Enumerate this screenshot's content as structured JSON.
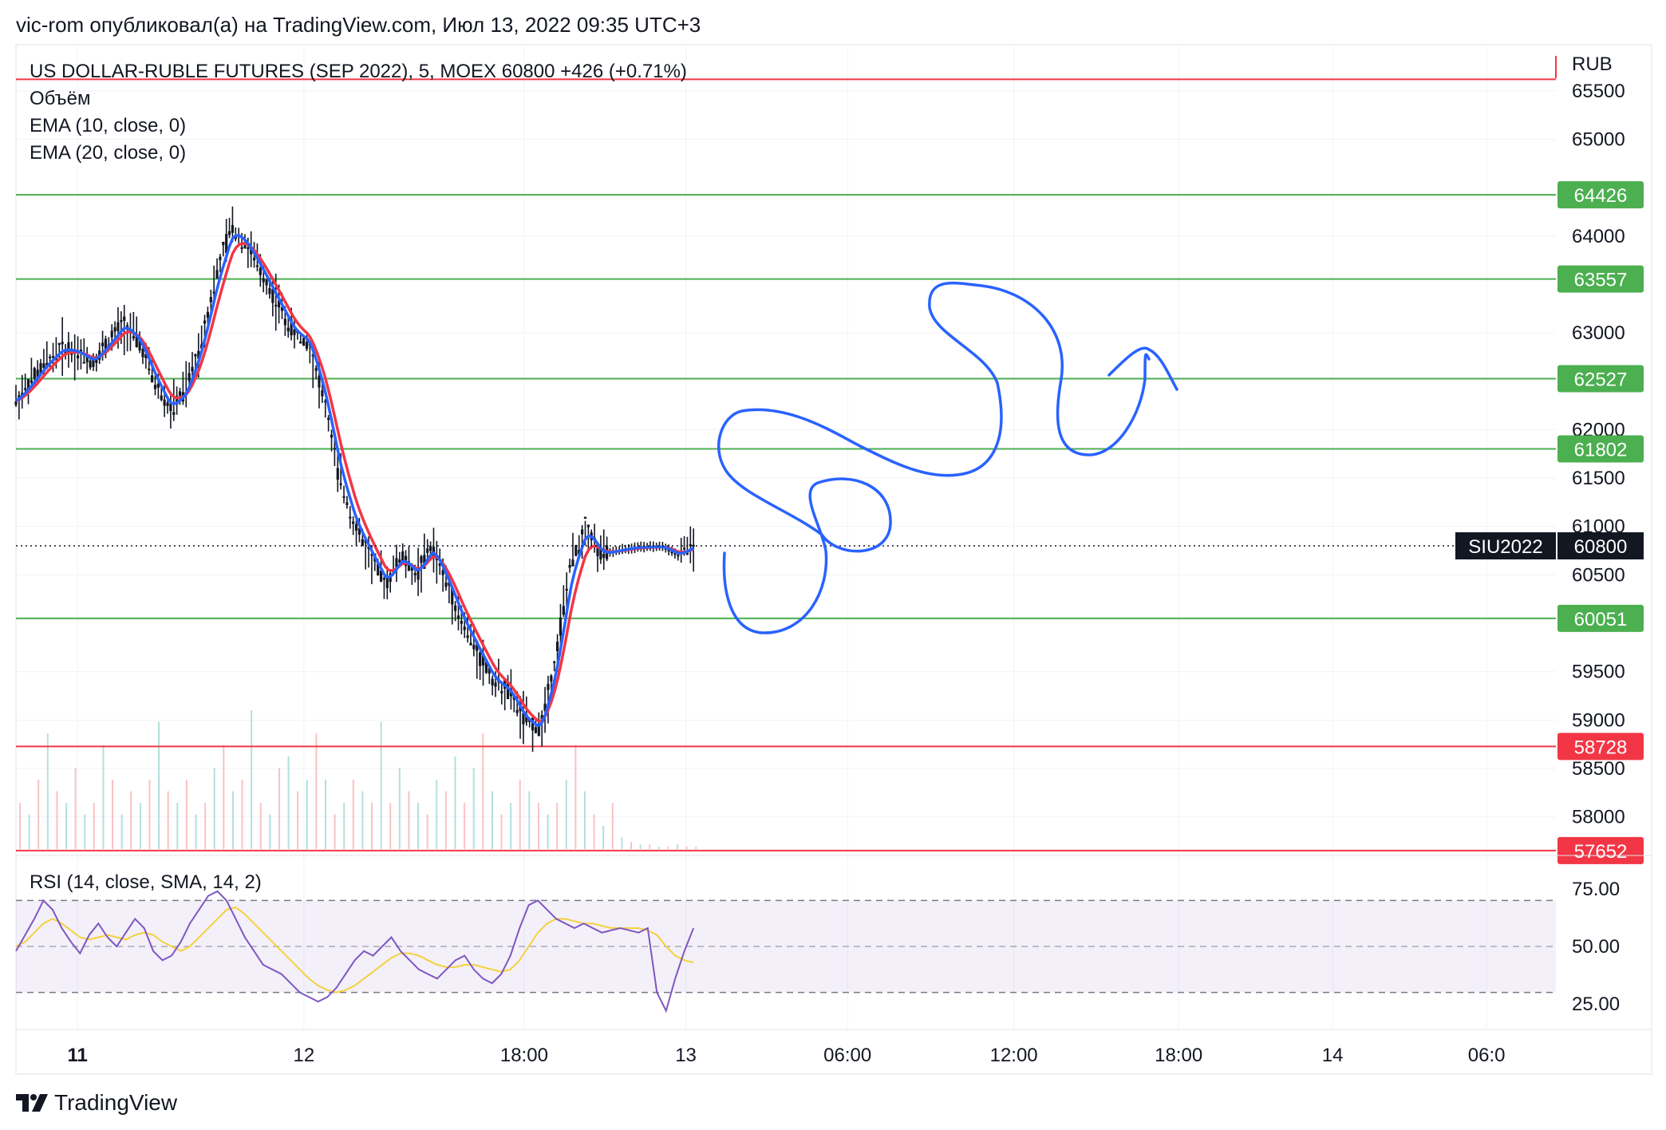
{
  "header": {
    "publisher_line": "vic-rom опубликовал(а) на TradingView.com, Июл 13, 2022 09:35 UTC+3"
  },
  "legend": {
    "title": "US DOLLAR-RUBLE FUTURES (SEP 2022), 5, MOEX  60800  +426 (+0.71%)",
    "volume": "Объём",
    "ema10": "EMA (10, close, 0)",
    "ema20": "EMA (20, close, 0)",
    "rsi": "RSI (14, close, SMA, 14, 2)"
  },
  "footer": {
    "brand": "TradingView"
  },
  "colors": {
    "level_line": "#4caf50",
    "red_line": "#f23645",
    "ema10": "#2962ff",
    "ema20": "#f23645",
    "rsi": "#7e57c2",
    "rsi_ma": "#f5d13d",
    "rsi_band": "#7e57c2",
    "drawing": "#2962ff",
    "candle": "#131722"
  },
  "chart_data": {
    "type": "candlestick",
    "symbol": "SIU2022",
    "currency": "RUB",
    "last_price": 60800,
    "change": "+426 (+0.71%)",
    "price_axis": {
      "range": [
        57700,
        65700
      ],
      "ticks": [
        "65500",
        "65000",
        "64000",
        "63000",
        "62000",
        "61500",
        "61000",
        "60500",
        "59500",
        "59000",
        "58500",
        "58000"
      ]
    },
    "time_axis": {
      "ticks": [
        {
          "label": "11",
          "bold": true,
          "pos": 0.04
        },
        {
          "label": "12",
          "bold": false,
          "pos": 0.187
        },
        {
          "label": "18:00",
          "bold": false,
          "pos": 0.33
        },
        {
          "label": "13",
          "bold": false,
          "pos": 0.435
        },
        {
          "label": "06:00",
          "bold": false,
          "pos": 0.54
        },
        {
          "label": "12:00",
          "bold": false,
          "pos": 0.648
        },
        {
          "label": "18:00",
          "bold": false,
          "pos": 0.755
        },
        {
          "label": "14",
          "bold": false,
          "pos": 0.855
        },
        {
          "label": "06:0",
          "bold": false,
          "pos": 0.955
        }
      ]
    },
    "levels": [
      {
        "price": 64426,
        "label": "64426",
        "color": "green"
      },
      {
        "price": 63557,
        "label": "63557",
        "color": "green"
      },
      {
        "price": 62527,
        "label": "62527",
        "color": "green"
      },
      {
        "price": 61802,
        "label": "61802",
        "color": "green"
      },
      {
        "price": 60051,
        "label": "60051",
        "color": "green"
      },
      {
        "price": 58728,
        "label": "58728",
        "color": "red"
      },
      {
        "price": 57652,
        "label": "57652",
        "color": "red"
      },
      {
        "price": 65620,
        "label": "",
        "color": "red"
      }
    ],
    "last_price_tag": {
      "symbol": "SIU2022",
      "price": "60800"
    },
    "price_path": [
      [
        0,
        62300
      ],
      [
        0.01,
        62500
      ],
      [
        0.02,
        62700
      ],
      [
        0.03,
        62850
      ],
      [
        0.04,
        62800
      ],
      [
        0.05,
        62700
      ],
      [
        0.06,
        62900
      ],
      [
        0.07,
        63100
      ],
      [
        0.08,
        62900
      ],
      [
        0.09,
        62500
      ],
      [
        0.1,
        62200
      ],
      [
        0.11,
        62400
      ],
      [
        0.12,
        62900
      ],
      [
        0.13,
        63600
      ],
      [
        0.14,
        64100
      ],
      [
        0.15,
        63900
      ],
      [
        0.16,
        63600
      ],
      [
        0.17,
        63300
      ],
      [
        0.18,
        63000
      ],
      [
        0.19,
        62900
      ],
      [
        0.2,
        62300
      ],
      [
        0.21,
        61500
      ],
      [
        0.22,
        61000
      ],
      [
        0.23,
        60700
      ],
      [
        0.24,
        60400
      ],
      [
        0.25,
        60700
      ],
      [
        0.26,
        60500
      ],
      [
        0.27,
        60800
      ],
      [
        0.28,
        60400
      ],
      [
        0.29,
        60000
      ],
      [
        0.3,
        59700
      ],
      [
        0.31,
        59400
      ],
      [
        0.32,
        59300
      ],
      [
        0.33,
        59000
      ],
      [
        0.34,
        58900
      ],
      [
        0.35,
        59600
      ],
      [
        0.36,
        60600
      ],
      [
        0.37,
        61000
      ],
      [
        0.38,
        60700
      ],
      [
        0.39,
        60750
      ],
      [
        0.4,
        60780
      ],
      [
        0.41,
        60790
      ],
      [
        0.42,
        60790
      ],
      [
        0.43,
        60700
      ],
      [
        0.44,
        60800
      ]
    ],
    "volume": [
      0.2,
      0.15,
      0.3,
      0.5,
      0.25,
      0.2,
      0.35,
      0.15,
      0.2,
      0.45,
      0.3,
      0.15,
      0.25,
      0.2,
      0.3,
      0.55,
      0.25,
      0.2,
      0.3,
      0.15,
      0.2,
      0.35,
      0.45,
      0.25,
      0.3,
      0.6,
      0.2,
      0.15,
      0.35,
      0.4,
      0.25,
      0.3,
      0.5,
      0.3,
      0.15,
      0.2,
      0.3,
      0.25,
      0.2,
      0.55,
      0.2,
      0.35,
      0.25,
      0.2,
      0.15,
      0.3,
      0.25,
      0.4,
      0.2,
      0.35,
      0.5,
      0.25,
      0.15,
      0.2,
      0.3,
      0.25,
      0.2,
      0.15,
      0.2,
      0.3,
      0.45,
      0.25,
      0.15,
      0.1,
      0.2,
      0.05,
      0.03,
      0.02,
      0.02,
      0.01,
      0.01,
      0.02,
      0.01,
      0.01
    ],
    "rsi": {
      "axis_ticks": [
        "75.00",
        "50.00",
        "25.00"
      ],
      "band": [
        30,
        70
      ],
      "middle": 50,
      "values": [
        48,
        55,
        62,
        70,
        66,
        58,
        52,
        47,
        55,
        60,
        54,
        50,
        56,
        62,
        58,
        48,
        44,
        46,
        52,
        60,
        66,
        72,
        74,
        70,
        62,
        54,
        48,
        42,
        40,
        38,
        34,
        30,
        28,
        26,
        28,
        32,
        38,
        44,
        48,
        46,
        50,
        54,
        48,
        44,
        40,
        38,
        36,
        40,
        44,
        46,
        40,
        36,
        34,
        38,
        46,
        58,
        68,
        70,
        66,
        62,
        60,
        58,
        60,
        58,
        56,
        57,
        58,
        57,
        56,
        58,
        30,
        22,
        36,
        48,
        58
      ],
      "ma_values": [
        50,
        52,
        56,
        60,
        62,
        60,
        57,
        54,
        53,
        54,
        55,
        54,
        53,
        55,
        56,
        55,
        52,
        50,
        48,
        50,
        54,
        58,
        62,
        66,
        67,
        64,
        60,
        56,
        52,
        48,
        44,
        40,
        36,
        33,
        31,
        30,
        31,
        33,
        36,
        39,
        42,
        45,
        47,
        47,
        46,
        44,
        42,
        41,
        41,
        42,
        42,
        41,
        40,
        39,
        40,
        44,
        50,
        56,
        60,
        62,
        62,
        61,
        60,
        60,
        59,
        58,
        58,
        58,
        58,
        57,
        55,
        50,
        46,
        44,
        43
      ]
    }
  }
}
